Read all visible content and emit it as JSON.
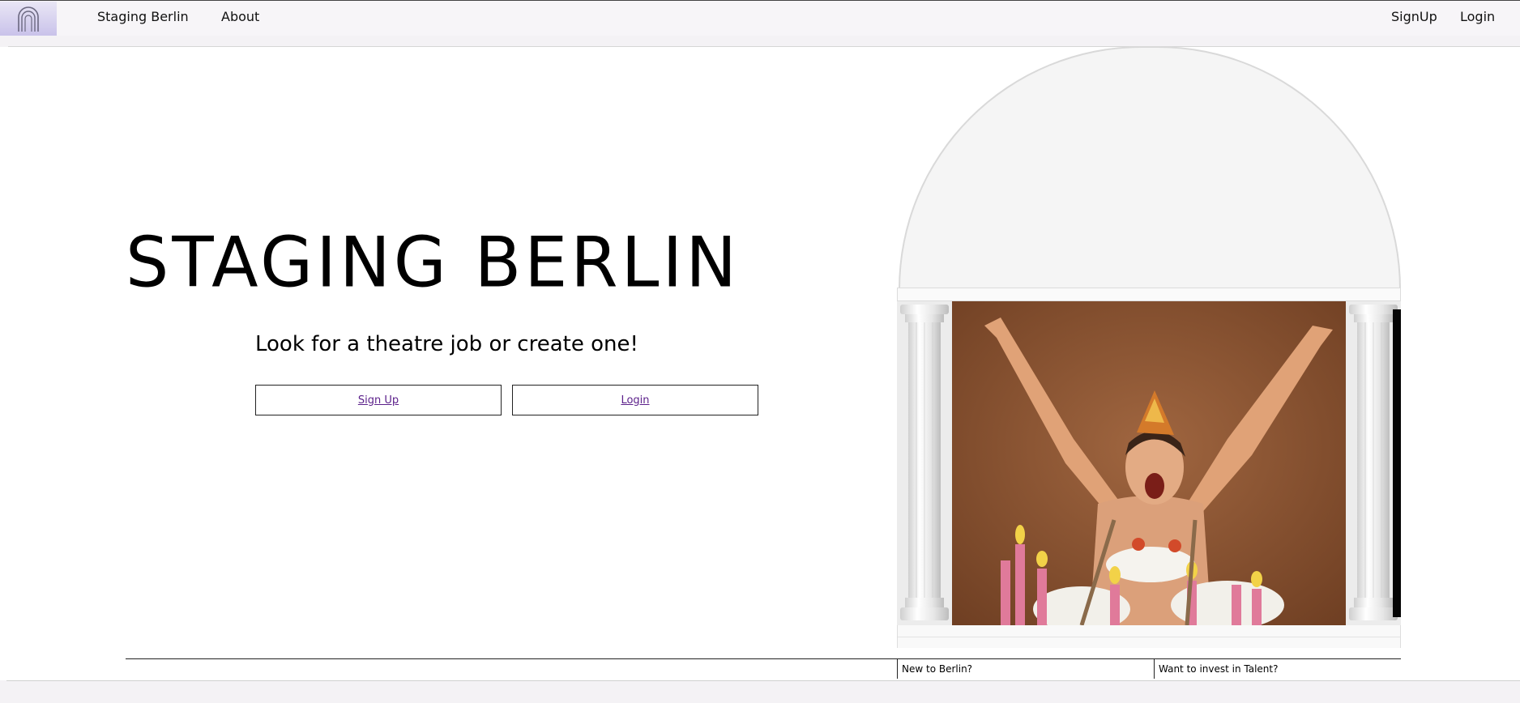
{
  "nav": {
    "logo_icon": "theatre-arch-logo-icon",
    "brand": "Staging Berlin",
    "about": "About",
    "signup": "SignUp",
    "login": "Login"
  },
  "hero": {
    "title": "STAGING BERLIN",
    "subtitle": "Look for a theatre job or create one!",
    "signup_button": "Sign Up",
    "login_button": "Login"
  },
  "illustration": {
    "arch_icon": "stage-arch-illustration",
    "photo_icon": "performer-photo"
  },
  "footer": {
    "new_to_berlin": "New to Berlin?",
    "invest": "Want to invest in Talent?"
  },
  "colors": {
    "logo_bg": "#c9c2ea",
    "link": "#5b1f8a",
    "photo_bg": "#8a5232"
  }
}
